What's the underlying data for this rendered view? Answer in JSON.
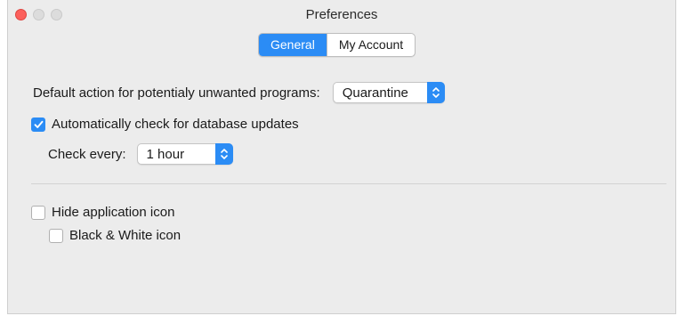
{
  "window": {
    "title": "Preferences"
  },
  "tabs": [
    {
      "label": "General",
      "active": true
    },
    {
      "label": "My Account",
      "active": false
    }
  ],
  "general": {
    "default_action_label": "Default action for potentialy unwanted programs:",
    "default_action_value": "Quarantine",
    "auto_check_label": "Automatically check for database updates",
    "auto_check_checked": true,
    "check_every_label": "Check every:",
    "check_every_value": "1 hour",
    "hide_icon_label": "Hide application icon",
    "hide_icon_checked": false,
    "bw_icon_label": "Black & White icon",
    "bw_icon_checked": false
  },
  "colors": {
    "accent": "#2b8cf5",
    "close_light": "#fc605c"
  }
}
